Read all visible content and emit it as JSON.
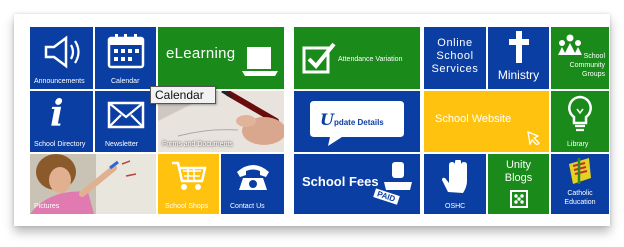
{
  "tiles": {
    "announcements": "Announcements",
    "calendar": "Calendar",
    "elearning": "eLearning",
    "attendance_variation": "Attendance Variation",
    "online_school_services_line1": "Online",
    "online_school_services_line2": "School",
    "online_school_services_line3": "Services",
    "ministry": "Ministry",
    "school_community_groups_line1": "School",
    "school_community_groups_line2": "Community",
    "school_community_groups_line3": "Groups",
    "school_directory": "School Directory",
    "newsletter": "Newsletter",
    "forms_and_documents": "Forms and Documents",
    "update_details_initial": "U",
    "update_details_rest": "pdate Details",
    "school_website": "School Website",
    "library": "Library",
    "pictures": "Pictures",
    "school_shops": "School Shops",
    "contact_us": "Contact Us",
    "school_fees": "School Fees",
    "paid_stamp": "PAID",
    "oshc": "OSHC",
    "unity_blogs_line1": "Unity",
    "unity_blogs_line2": "Blogs",
    "catholic_education_line1": "Catholic",
    "catholic_education_line2": "Education"
  },
  "tooltip": "Calendar",
  "colors": {
    "blue": "#0b3ea3",
    "green": "#1a8a1a",
    "yellow": "#ffc20e"
  }
}
